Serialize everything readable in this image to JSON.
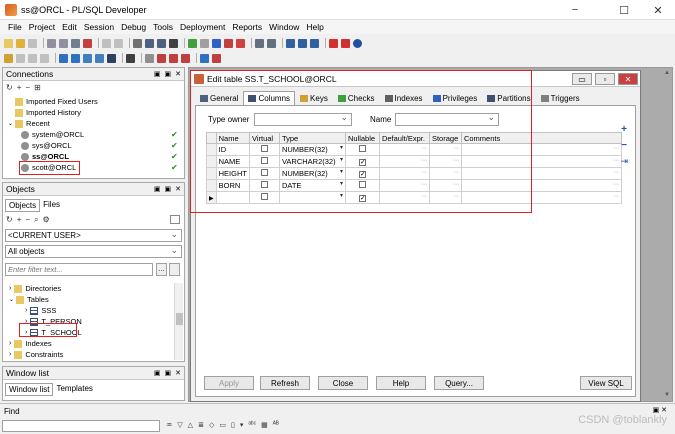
{
  "window": {
    "title": "ss@ORCL - PL/SQL Developer",
    "minimize": "−",
    "maximize": "☐",
    "close": "✕"
  },
  "menu": [
    "File",
    "Project",
    "Edit",
    "Session",
    "Debug",
    "Tools",
    "Deployment",
    "Reports",
    "Window",
    "Help"
  ],
  "connections": {
    "header": "Connections",
    "items": [
      "Imported Fixed Users",
      "Imported History",
      "Recent",
      "system@ORCL",
      "sys@ORCL",
      "ss@ORCL",
      "scott@ORCL"
    ]
  },
  "objects": {
    "header": "Objects",
    "tabs": [
      "Objects",
      "Files"
    ],
    "user_select": "<CURRENT USER>",
    "filter_select": "All objects",
    "filter_placeholder": "Enter filter text...",
    "tree": [
      "Directories",
      "Tables",
      "SSS",
      "T_PERSON",
      "T_SCHOOL",
      "Indexes",
      "Constraints"
    ]
  },
  "windowlist": {
    "header": "Window list",
    "tabs": [
      "Window list",
      "Templates"
    ]
  },
  "find": {
    "label": "Find"
  },
  "editor": {
    "title": "Edit table SS.T_SCHOOL@ORCL",
    "tabs": [
      "General",
      "Columns",
      "Keys",
      "Checks",
      "Indexes",
      "Privileges",
      "Partitions",
      "Triggers"
    ],
    "type_owner_label": "Type owner",
    "name_label": "Name",
    "headers": [
      "Name",
      "Virtual",
      "Type",
      "Nullable",
      "Default/Expr.",
      "Storage",
      "Comments"
    ],
    "rows": [
      {
        "name": "ID",
        "type": "NUMBER(32)",
        "nullable": false
      },
      {
        "name": "NAME",
        "type": "VARCHAR2(32)",
        "nullable": true
      },
      {
        "name": "HEIGHT",
        "type": "NUMBER(32)",
        "nullable": true
      },
      {
        "name": "BORN",
        "type": "DATE",
        "nullable": false
      },
      {
        "name": "",
        "type": "",
        "nullable": true
      }
    ],
    "buttons": {
      "apply": "Apply",
      "refresh": "Refresh",
      "close": "Close",
      "help": "Help",
      "query": "Query...",
      "viewsql": "View SQL"
    }
  },
  "watermark": "CSDN @toblankly",
  "colors": {
    "highlight": "#e02020",
    "accent": "#3070c0"
  }
}
